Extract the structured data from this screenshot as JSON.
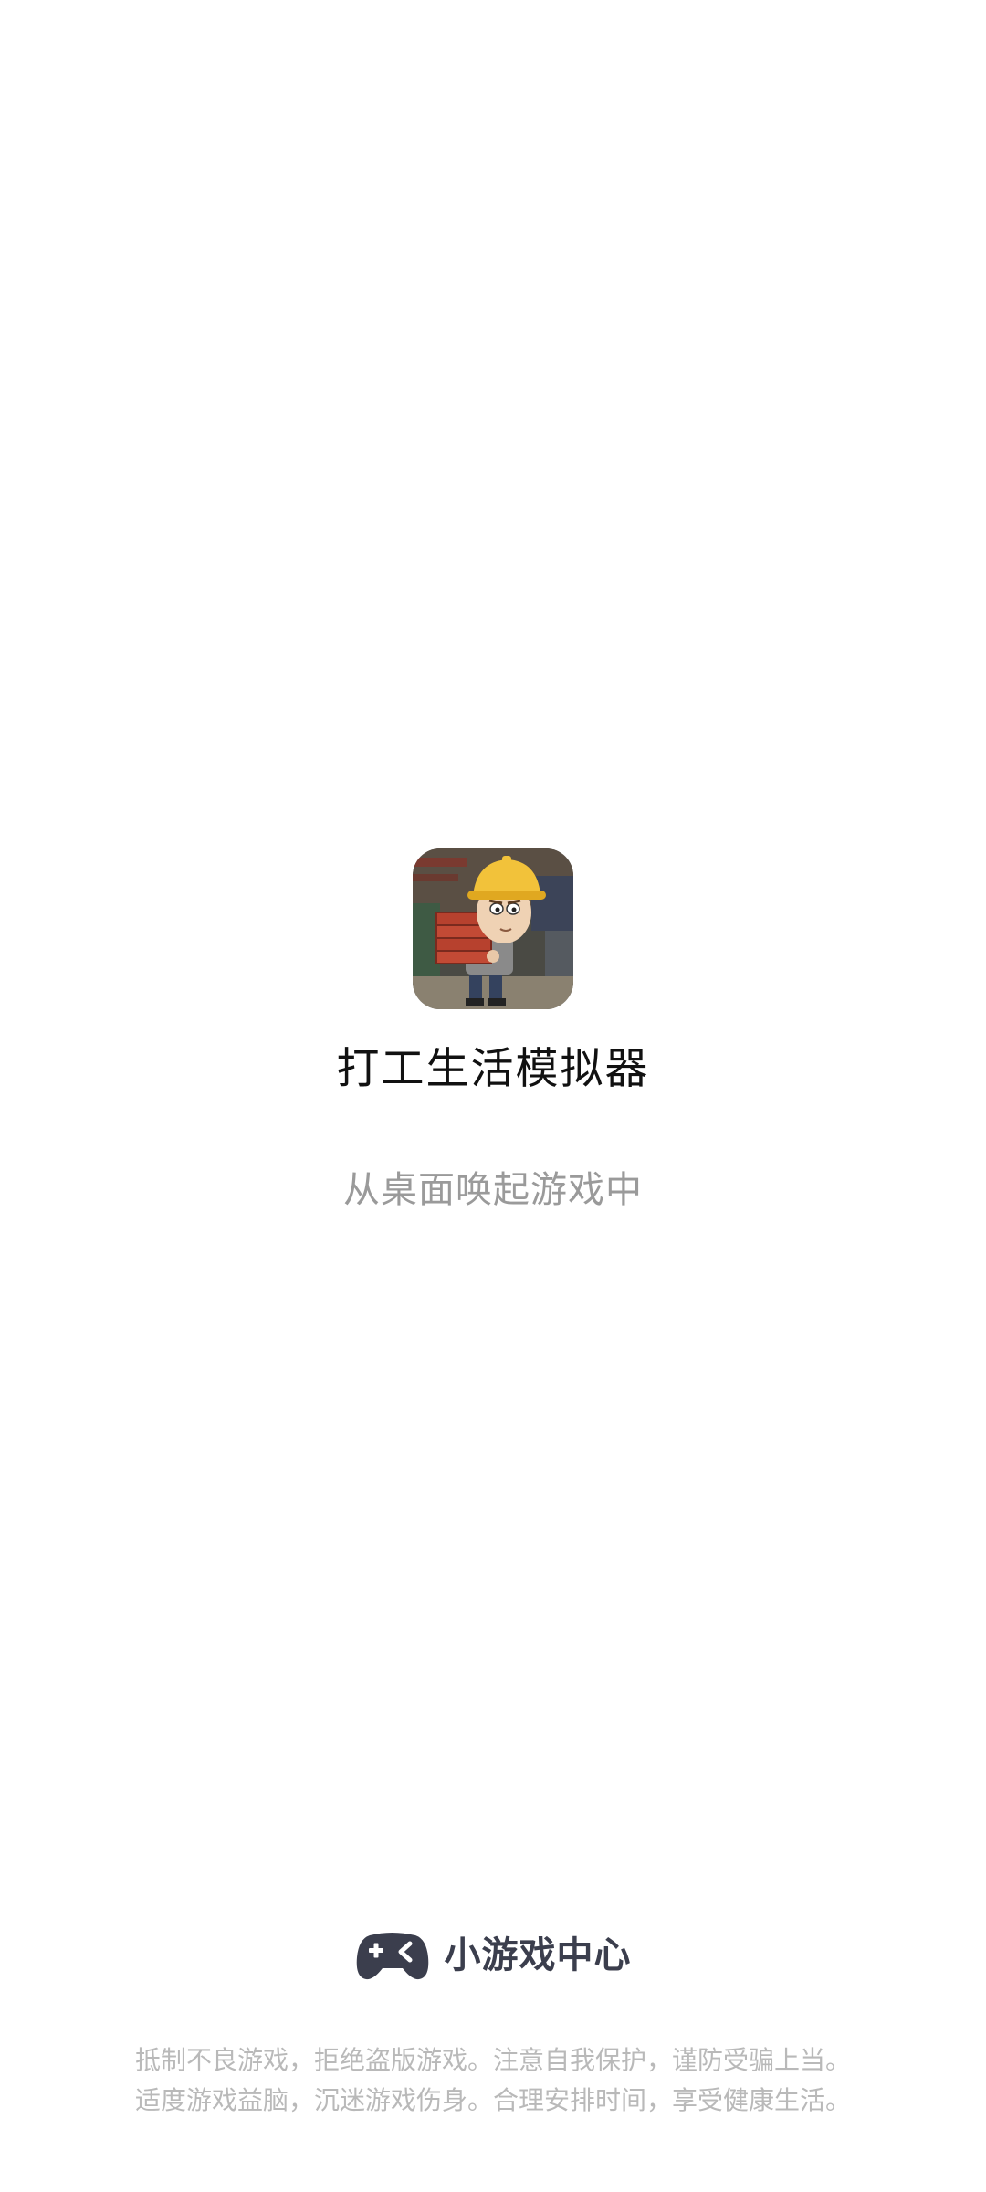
{
  "app": {
    "name": "打工生活模拟器",
    "icon": "worker-carrying-bricks-icon"
  },
  "status": {
    "text": "从桌面唤起游戏中"
  },
  "brand": {
    "logo": "gamepad-icon",
    "name": "小游戏中心"
  },
  "notice": {
    "line1": "抵制不良游戏，拒绝盗版游戏。注意自我保护，谨防受骗上当。",
    "line2": "适度游戏益脑，沉迷游戏伤身。合理安排时间，享受健康生活。"
  },
  "colors": {
    "background": "#ffffff",
    "title": "#111111",
    "status": "#9a9a9a",
    "brand": "#3b3e4d",
    "notice": "#b9b9b9"
  }
}
